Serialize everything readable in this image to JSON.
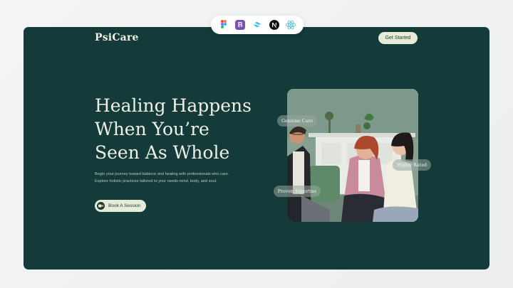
{
  "tech_stack": {
    "icons": [
      "figma-icon",
      "bootstrap-icon",
      "tailwind-icon",
      "nextjs-icon",
      "react-icon"
    ]
  },
  "nav": {
    "logo": "PsiCare",
    "cta_label": "Get Started"
  },
  "hero": {
    "headline_lines": [
      "Healing Happens",
      "When You’re",
      "Seen As Whole"
    ],
    "description_lines": [
      "Begin your journey toward balance and healing with professionals who care.",
      "Explore holistic practices tailored to your needs-mind, body, and soul."
    ],
    "book_label": "Book A Session",
    "book_icon": "video-camera-icon"
  },
  "photo": {
    "tags": [
      "Genuine Care",
      "Highly Rated",
      "Proven Expertise"
    ]
  },
  "colors": {
    "hero_background": "#153a3a",
    "accent_pill": "#e7ecd9",
    "headline_text": "#eef0e5"
  }
}
